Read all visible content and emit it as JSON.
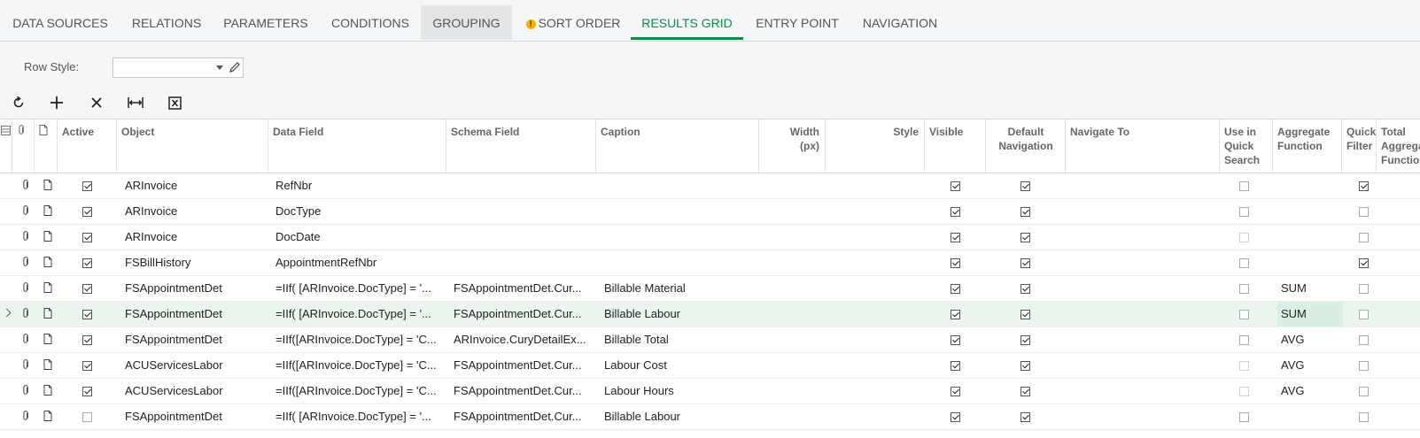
{
  "tabs": [
    {
      "label": "DATA SOURCES"
    },
    {
      "label": "RELATIONS"
    },
    {
      "label": "PARAMETERS"
    },
    {
      "label": "CONDITIONS"
    },
    {
      "label": "GROUPING"
    },
    {
      "label": "SORT ORDER"
    },
    {
      "label": "RESULTS GRID"
    },
    {
      "label": "ENTRY POINT"
    },
    {
      "label": "NAVIGATION"
    }
  ],
  "warning_glyph": "!",
  "row_style": {
    "label": "Row Style:",
    "value": ""
  },
  "toolbar": {
    "icons": [
      "refresh-icon",
      "add-icon",
      "delete-icon",
      "fit-columns-icon",
      "export-excel-icon"
    ]
  },
  "columns": {
    "active": "Active",
    "object": "Object",
    "data_field": "Data Field",
    "schema_field": "Schema Field",
    "caption": "Caption",
    "width": "Width (px)",
    "style": "Style",
    "visible": "Visible",
    "default_nav": "Default Navigation",
    "navigate_to": "Navigate To",
    "quick_search": "Use in Quick Search",
    "aggregate": "Aggregate Function",
    "quick_filter": "Quick Filter",
    "total_aggregate": "Total Aggregate Function"
  },
  "rows": [
    {
      "active": true,
      "object": "ARInvoice",
      "data_field": "RefNbr",
      "schema_field": "",
      "caption": "",
      "visible": true,
      "default_nav": true,
      "quick_search": false,
      "aggregate": "",
      "quick_filter": true
    },
    {
      "active": true,
      "object": "ARInvoice",
      "data_field": "DocType",
      "schema_field": "",
      "caption": "",
      "visible": true,
      "default_nav": true,
      "quick_search": false,
      "aggregate": "",
      "quick_filter": false
    },
    {
      "active": true,
      "object": "ARInvoice",
      "data_field": "DocDate",
      "schema_field": "",
      "caption": "",
      "visible": true,
      "default_nav": true,
      "quick_search": false,
      "aggregate": "",
      "quick_filter": false
    },
    {
      "active": true,
      "object": "FSBillHistory",
      "data_field": "AppointmentRefNbr",
      "schema_field": "",
      "caption": "",
      "visible": true,
      "default_nav": true,
      "quick_search": false,
      "aggregate": "",
      "quick_filter": true
    },
    {
      "active": true,
      "object": "FSAppointmentDet",
      "data_field": "=IIf( [ARInvoice.DocType] = '...",
      "schema_field": "FSAppointmentDet.Cur...",
      "caption": "Billable Material",
      "visible": true,
      "default_nav": true,
      "quick_search": false,
      "aggregate": "SUM",
      "quick_filter": false
    },
    {
      "active": true,
      "object": "FSAppointmentDet",
      "data_field": "=IIf( [ARInvoice.DocType] = '...",
      "schema_field": "FSAppointmentDet.Cur...",
      "caption": "Billable Labour",
      "visible": true,
      "default_nav": true,
      "quick_search": false,
      "aggregate": "SUM",
      "quick_filter": false
    },
    {
      "active": true,
      "object": "FSAppointmentDet",
      "data_field": "=IIf([ARInvoice.DocType] = 'C...",
      "schema_field": "ARInvoice.CuryDetailEx...",
      "caption": "Billable Total",
      "visible": true,
      "default_nav": true,
      "quick_search": false,
      "aggregate": "AVG",
      "quick_filter": false
    },
    {
      "active": true,
      "object": "ACUServicesLabor",
      "data_field": "=IIf([ARInvoice.DocType] = 'C...",
      "schema_field": "FSAppointmentDet.Cur...",
      "caption": "Labour Cost",
      "visible": true,
      "default_nav": true,
      "quick_search": false,
      "aggregate": "AVG",
      "quick_filter": false
    },
    {
      "active": true,
      "object": "ACUServicesLabor",
      "data_field": "=IIf([ARInvoice.DocType] = 'C...",
      "schema_field": "FSAppointmentDet.Cur...",
      "caption": "Labour Hours",
      "visible": true,
      "default_nav": true,
      "quick_search": false,
      "aggregate": "AVG",
      "quick_filter": false
    },
    {
      "active": false,
      "object": "FSAppointmentDet",
      "data_field": "=IIf( [ARInvoice.DocType] = '...",
      "schema_field": "FSAppointmentDet.Cur...",
      "caption": "Billable Labour",
      "visible": true,
      "default_nav": true,
      "quick_search": false,
      "aggregate": "",
      "quick_filter": false
    }
  ],
  "colors": {
    "accent": "#108a4a",
    "selected_row": "#eaf5ee",
    "warning": "#f0b400"
  }
}
